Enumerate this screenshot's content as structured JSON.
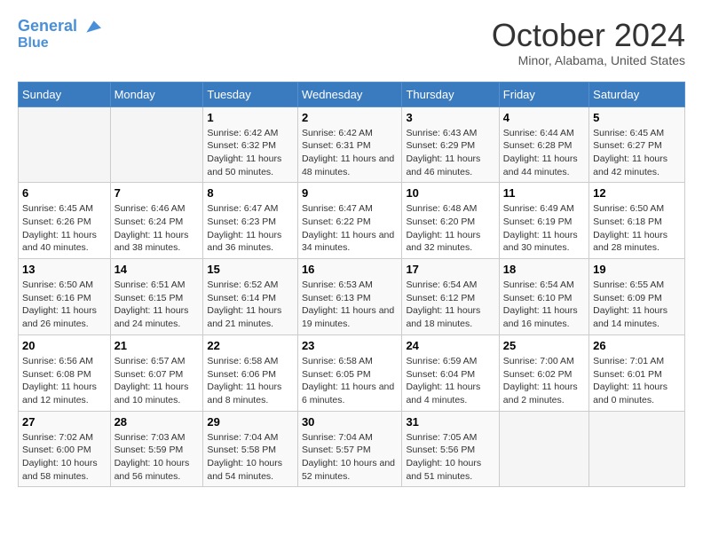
{
  "header": {
    "logo_line1": "General",
    "logo_line2": "Blue",
    "month_title": "October 2024",
    "location": "Minor, Alabama, United States"
  },
  "days_of_week": [
    "Sunday",
    "Monday",
    "Tuesday",
    "Wednesday",
    "Thursday",
    "Friday",
    "Saturday"
  ],
  "weeks": [
    [
      {
        "day": "",
        "info": ""
      },
      {
        "day": "",
        "info": ""
      },
      {
        "day": "1",
        "info": "Sunrise: 6:42 AM\nSunset: 6:32 PM\nDaylight: 11 hours and 50 minutes."
      },
      {
        "day": "2",
        "info": "Sunrise: 6:42 AM\nSunset: 6:31 PM\nDaylight: 11 hours and 48 minutes."
      },
      {
        "day": "3",
        "info": "Sunrise: 6:43 AM\nSunset: 6:29 PM\nDaylight: 11 hours and 46 minutes."
      },
      {
        "day": "4",
        "info": "Sunrise: 6:44 AM\nSunset: 6:28 PM\nDaylight: 11 hours and 44 minutes."
      },
      {
        "day": "5",
        "info": "Sunrise: 6:45 AM\nSunset: 6:27 PM\nDaylight: 11 hours and 42 minutes."
      }
    ],
    [
      {
        "day": "6",
        "info": "Sunrise: 6:45 AM\nSunset: 6:26 PM\nDaylight: 11 hours and 40 minutes."
      },
      {
        "day": "7",
        "info": "Sunrise: 6:46 AM\nSunset: 6:24 PM\nDaylight: 11 hours and 38 minutes."
      },
      {
        "day": "8",
        "info": "Sunrise: 6:47 AM\nSunset: 6:23 PM\nDaylight: 11 hours and 36 minutes."
      },
      {
        "day": "9",
        "info": "Sunrise: 6:47 AM\nSunset: 6:22 PM\nDaylight: 11 hours and 34 minutes."
      },
      {
        "day": "10",
        "info": "Sunrise: 6:48 AM\nSunset: 6:20 PM\nDaylight: 11 hours and 32 minutes."
      },
      {
        "day": "11",
        "info": "Sunrise: 6:49 AM\nSunset: 6:19 PM\nDaylight: 11 hours and 30 minutes."
      },
      {
        "day": "12",
        "info": "Sunrise: 6:50 AM\nSunset: 6:18 PM\nDaylight: 11 hours and 28 minutes."
      }
    ],
    [
      {
        "day": "13",
        "info": "Sunrise: 6:50 AM\nSunset: 6:16 PM\nDaylight: 11 hours and 26 minutes."
      },
      {
        "day": "14",
        "info": "Sunrise: 6:51 AM\nSunset: 6:15 PM\nDaylight: 11 hours and 24 minutes."
      },
      {
        "day": "15",
        "info": "Sunrise: 6:52 AM\nSunset: 6:14 PM\nDaylight: 11 hours and 21 minutes."
      },
      {
        "day": "16",
        "info": "Sunrise: 6:53 AM\nSunset: 6:13 PM\nDaylight: 11 hours and 19 minutes."
      },
      {
        "day": "17",
        "info": "Sunrise: 6:54 AM\nSunset: 6:12 PM\nDaylight: 11 hours and 18 minutes."
      },
      {
        "day": "18",
        "info": "Sunrise: 6:54 AM\nSunset: 6:10 PM\nDaylight: 11 hours and 16 minutes."
      },
      {
        "day": "19",
        "info": "Sunrise: 6:55 AM\nSunset: 6:09 PM\nDaylight: 11 hours and 14 minutes."
      }
    ],
    [
      {
        "day": "20",
        "info": "Sunrise: 6:56 AM\nSunset: 6:08 PM\nDaylight: 11 hours and 12 minutes."
      },
      {
        "day": "21",
        "info": "Sunrise: 6:57 AM\nSunset: 6:07 PM\nDaylight: 11 hours and 10 minutes."
      },
      {
        "day": "22",
        "info": "Sunrise: 6:58 AM\nSunset: 6:06 PM\nDaylight: 11 hours and 8 minutes."
      },
      {
        "day": "23",
        "info": "Sunrise: 6:58 AM\nSunset: 6:05 PM\nDaylight: 11 hours and 6 minutes."
      },
      {
        "day": "24",
        "info": "Sunrise: 6:59 AM\nSunset: 6:04 PM\nDaylight: 11 hours and 4 minutes."
      },
      {
        "day": "25",
        "info": "Sunrise: 7:00 AM\nSunset: 6:02 PM\nDaylight: 11 hours and 2 minutes."
      },
      {
        "day": "26",
        "info": "Sunrise: 7:01 AM\nSunset: 6:01 PM\nDaylight: 11 hours and 0 minutes."
      }
    ],
    [
      {
        "day": "27",
        "info": "Sunrise: 7:02 AM\nSunset: 6:00 PM\nDaylight: 10 hours and 58 minutes."
      },
      {
        "day": "28",
        "info": "Sunrise: 7:03 AM\nSunset: 5:59 PM\nDaylight: 10 hours and 56 minutes."
      },
      {
        "day": "29",
        "info": "Sunrise: 7:04 AM\nSunset: 5:58 PM\nDaylight: 10 hours and 54 minutes."
      },
      {
        "day": "30",
        "info": "Sunrise: 7:04 AM\nSunset: 5:57 PM\nDaylight: 10 hours and 52 minutes."
      },
      {
        "day": "31",
        "info": "Sunrise: 7:05 AM\nSunset: 5:56 PM\nDaylight: 10 hours and 51 minutes."
      },
      {
        "day": "",
        "info": ""
      },
      {
        "day": "",
        "info": ""
      }
    ]
  ]
}
